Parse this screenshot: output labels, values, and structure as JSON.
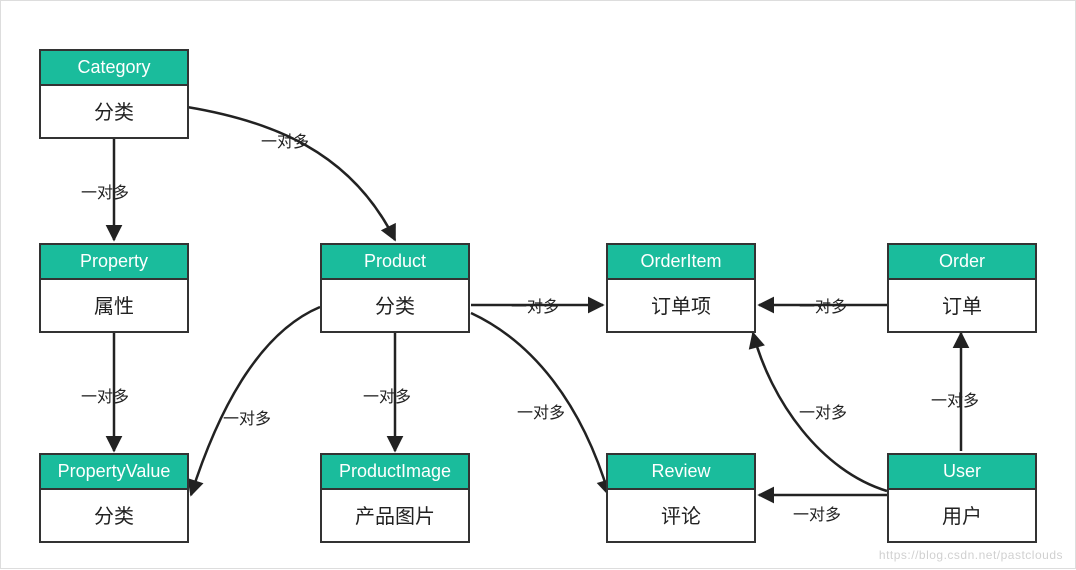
{
  "entities": {
    "category": {
      "title": "Category",
      "label": "分类"
    },
    "property": {
      "title": "Property",
      "label": "属性"
    },
    "product": {
      "title": "Product",
      "label": "分类"
    },
    "orderItem": {
      "title": "OrderItem",
      "label": "订单项"
    },
    "order": {
      "title": "Order",
      "label": "订单"
    },
    "propertyValue": {
      "title": "PropertyValue",
      "label": "分类"
    },
    "productImage": {
      "title": "ProductImage",
      "label": "产品图片"
    },
    "review": {
      "title": "Review",
      "label": "评论"
    },
    "user": {
      "title": "User",
      "label": "用户"
    }
  },
  "edgeLabels": {
    "cat_prop": "一对多",
    "cat_prod": "一对多",
    "prop_pv": "一对多",
    "prod_pv": "一对多",
    "prod_pi": "一对多",
    "prod_oi": "一对多",
    "prod_rev": "一对多",
    "order_oi": "一对多",
    "user_oi": "一对多",
    "user_order": "一对多",
    "user_rev": "一对多"
  },
  "watermark": "https://blog.csdn.net/pastclouds"
}
